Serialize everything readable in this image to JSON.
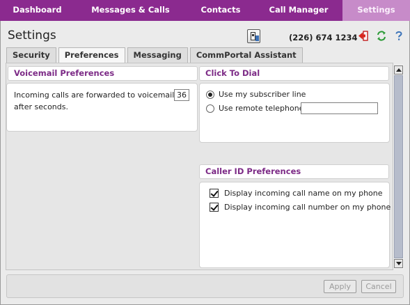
{
  "nav": {
    "items": [
      {
        "label": "Dashboard",
        "active": false
      },
      {
        "label": "Messages & Calls",
        "active": false
      },
      {
        "label": "Contacts",
        "active": false
      },
      {
        "label": "Call Manager",
        "active": false
      },
      {
        "label": "Settings",
        "active": true
      }
    ],
    "colors": {
      "bar": "#8b2a8f",
      "active": "#c78bc9"
    }
  },
  "header": {
    "title": "Settings",
    "phone_number": "(226) 674 1234",
    "icons": [
      "phone-settings-icon",
      "logout-icon",
      "refresh-icon",
      "help-icon"
    ]
  },
  "tabs": [
    {
      "label": "Security",
      "active": false
    },
    {
      "label": "Preferences",
      "active": true
    },
    {
      "label": "Messaging",
      "active": false
    },
    {
      "label": "CommPortal Assistant",
      "active": false
    }
  ],
  "voicemail": {
    "title": "Voicemail Preferences",
    "text": "Incoming calls are forwarded to voicemail after seconds.",
    "seconds": "36"
  },
  "click_to_dial": {
    "title": "Click To Dial",
    "options": [
      {
        "label": "Use my subscriber line",
        "selected": true
      },
      {
        "label": "Use remote telephone",
        "selected": false
      }
    ],
    "remote_number": ""
  },
  "caller_id": {
    "title": "Caller ID Preferences",
    "options": [
      {
        "label": "Display incoming call name on my phone",
        "checked": true
      },
      {
        "label": "Display incoming call number on my phone",
        "checked": true
      }
    ]
  },
  "footer": {
    "apply_label": "Apply",
    "cancel_label": "Cancel"
  },
  "accent_color": "#7c2a86"
}
